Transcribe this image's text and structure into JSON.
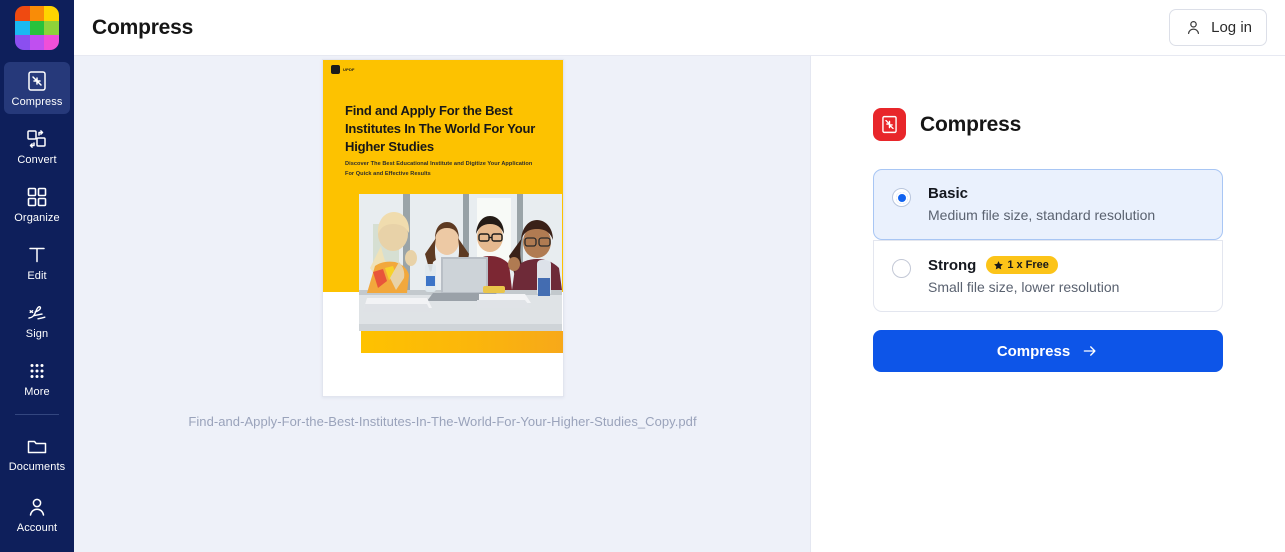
{
  "brand": {
    "logo_name": "app-logo-grid",
    "logo_colors": [
      "#ef4a11",
      "#f98c07",
      "#ffd400",
      "#1ab9f2",
      "#27c23c",
      "#8ed33a",
      "#8b4ff0",
      "#c04ff0",
      "#f04fd8"
    ]
  },
  "sidebar": {
    "items": [
      {
        "label": "Compress",
        "icon": "compress-icon",
        "active": true
      },
      {
        "label": "Convert",
        "icon": "convert-icon",
        "active": false
      },
      {
        "label": "Organize",
        "icon": "organize-icon",
        "active": false
      },
      {
        "label": "Edit",
        "icon": "edit-text-icon",
        "active": false
      },
      {
        "label": "Sign",
        "icon": "signature-icon",
        "active": false
      },
      {
        "label": "More",
        "icon": "grid-dots-icon",
        "active": false
      }
    ],
    "documents": {
      "label": "Documents",
      "icon": "folder-icon"
    },
    "account": {
      "label": "Account",
      "icon": "person-icon"
    },
    "bg_color": "#0e1f5b",
    "active_bg_color": "#26397a"
  },
  "header": {
    "title": "Compress",
    "login_label": "Log in",
    "login_icon": "person-icon"
  },
  "preview": {
    "filename": "Find-and-Apply-For-the-Best-Institutes-In-The-World-For-Your-Higher-Studies_Copy.pdf",
    "document": {
      "brand_text": "UPDF",
      "heading": "Find and Apply For the Best Institutes In The World For Your Higher Studies",
      "subheading": "Discover The Best Educational Institute and Digitize Your Application For Quick and Effective Results",
      "accent_color": "#fdc200",
      "photo_alt": "four-students-studying-with-laptop"
    },
    "bg_color": "#eef1f9"
  },
  "panel": {
    "icon": "compress-icon",
    "icon_color": "#e8262a",
    "title": "Compress",
    "options": [
      {
        "name": "Basic",
        "description": "Medium file size, standard resolution",
        "selected": true,
        "badge": null
      },
      {
        "name": "Strong",
        "description": "Small file size, lower resolution",
        "selected": false,
        "badge": {
          "text": "1 x Free",
          "icon": "star-icon",
          "color": "#fcc419"
        }
      }
    ],
    "action": {
      "label": "Compress",
      "icon": "arrow-right-icon",
      "color": "#0d55e8"
    }
  }
}
